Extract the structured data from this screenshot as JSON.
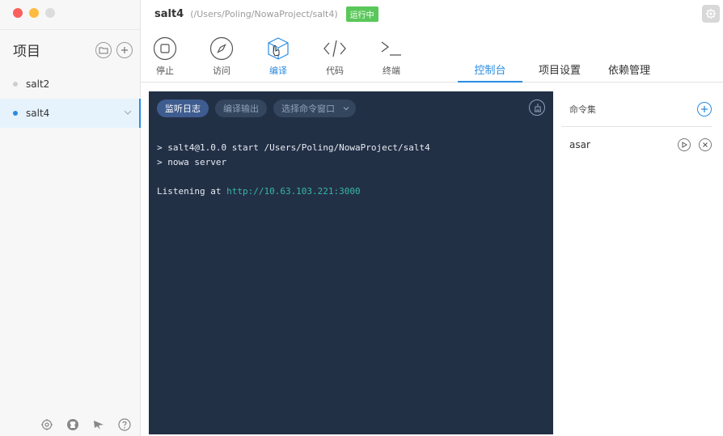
{
  "sidebar": {
    "title": "项目",
    "projects": [
      {
        "name": "salt2",
        "active": false
      },
      {
        "name": "salt4",
        "active": true
      }
    ]
  },
  "header": {
    "app_name": "salt4",
    "path": "(/Users/Poling/NowaProject/salt4)",
    "status": "运行中"
  },
  "toolbar": {
    "tools": [
      {
        "label": "停止"
      },
      {
        "label": "访问"
      },
      {
        "label": "编译"
      },
      {
        "label": "代码"
      },
      {
        "label": "终端"
      }
    ]
  },
  "tabs": [
    {
      "label": "控制台",
      "active": true
    },
    {
      "label": "项目设置",
      "active": false
    },
    {
      "label": "依赖管理",
      "active": false
    }
  ],
  "console": {
    "buttons": {
      "watch_log": "监听日志",
      "build_output": "编译输出",
      "select_window": "选择命令窗口"
    },
    "lines": [
      "> salt4@1.0.0 start /Users/Poling/NowaProject/salt4",
      "> nowa server"
    ],
    "listening_prefix": "Listening at ",
    "listening_url": "http://10.63.103.221:3000"
  },
  "commands": {
    "title": "命令集",
    "items": [
      {
        "name": "asar"
      }
    ]
  },
  "colors": {
    "accent": "#2a8ce0",
    "console_bg": "#223046",
    "status_green": "#5ac75a",
    "url_green": "#36b7a4"
  }
}
